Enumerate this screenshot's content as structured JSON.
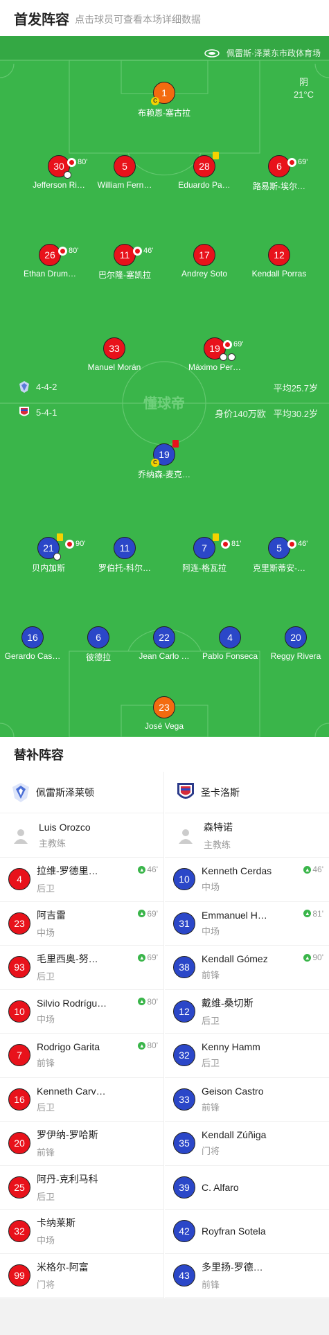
{
  "header": {
    "title": "首发阵容",
    "subtitle": "点击球员可查看本场详细数据"
  },
  "venue": {
    "name": "佩雷斯·泽莱东市政体育场"
  },
  "weather": {
    "condition": "阴",
    "temp": "21°C"
  },
  "watermark": "懂球帝",
  "home": {
    "formation": "4-4-2",
    "avg_age": "平均25.7岁",
    "players": [
      {
        "num": "1",
        "name": "布赖恩-塞古拉",
        "cap": true,
        "color": "orange"
      },
      {
        "num": "30",
        "name": "Jefferson Ri…",
        "sub": "80'",
        "ball": true
      },
      {
        "num": "5",
        "name": "William Fern…"
      },
      {
        "num": "28",
        "name": "Eduardo Pa…",
        "yellow": true
      },
      {
        "num": "6",
        "name": "路易斯-埃尔…",
        "sub": "69'"
      },
      {
        "num": "26",
        "name": "Ethan Drum…",
        "sub": "80'"
      },
      {
        "num": "11",
        "name": "巴尔隆-塞凯拉",
        "sub": "46'"
      },
      {
        "num": "17",
        "name": "Andrey Soto"
      },
      {
        "num": "12",
        "name": "Kendall Porras"
      },
      {
        "num": "33",
        "name": "Manuel Morán"
      },
      {
        "num": "19",
        "name": "Máximo Per…",
        "sub": "69'",
        "balls": 2
      }
    ]
  },
  "away": {
    "formation": "5-4-1",
    "value": "身价140万欧",
    "avg_age": "平均30.2岁",
    "players": [
      {
        "num": "19",
        "name": "乔纳森-麦克…",
        "cap": true,
        "red": true
      },
      {
        "num": "21",
        "name": "贝内加斯",
        "sub": "90'",
        "yellow": true,
        "ball": true
      },
      {
        "num": "11",
        "name": "罗伯托-科尔…"
      },
      {
        "num": "7",
        "name": "阿连-格瓦拉",
        "sub": "81'",
        "yellow": true
      },
      {
        "num": "5",
        "name": "克里斯蒂安-…",
        "sub": "46'"
      },
      {
        "num": "16",
        "name": "Gerardo Cas…"
      },
      {
        "num": "6",
        "name": "彼德拉"
      },
      {
        "num": "22",
        "name": "Jean Carlo …"
      },
      {
        "num": "4",
        "name": "Pablo Fonseca"
      },
      {
        "num": "20",
        "name": "Reggy Rivera"
      },
      {
        "num": "23",
        "name": "José Vega",
        "color": "orange"
      }
    ]
  },
  "subs": {
    "title": "替补阵容",
    "home": {
      "team": "佩雷斯泽莱顿",
      "coach": {
        "name": "Luis Orozco",
        "role": "主教练"
      },
      "list": [
        {
          "num": "4",
          "name": "拉维-罗德里…",
          "role": "后卫",
          "time": "46'"
        },
        {
          "num": "23",
          "name": "阿吉雷",
          "role": "中场",
          "time": "69'"
        },
        {
          "num": "93",
          "name": "毛里西奥-努…",
          "role": "后卫",
          "time": "69'"
        },
        {
          "num": "10",
          "name": "Silvio Rodrígu…",
          "role": "中场",
          "time": "80'"
        },
        {
          "num": "7",
          "name": "Rodrigo Garita",
          "role": "前锋",
          "time": "80'"
        },
        {
          "num": "16",
          "name": "Kenneth Carv…",
          "role": "后卫",
          "time": ""
        },
        {
          "num": "20",
          "name": "罗伊纳-罗哈斯",
          "role": "前锋",
          "time": ""
        },
        {
          "num": "25",
          "name": "阿丹-克利马科",
          "role": "后卫",
          "time": ""
        },
        {
          "num": "32",
          "name": "卡纳莱斯",
          "role": "中场",
          "time": ""
        },
        {
          "num": "99",
          "name": "米格尔-阿富",
          "role": "门将",
          "time": ""
        }
      ]
    },
    "away": {
      "team": "圣卡洛斯",
      "coach": {
        "name": "森特诺",
        "role": "主教练"
      },
      "list": [
        {
          "num": "10",
          "name": "Kenneth Cerdas",
          "role": "中场",
          "time": "46'"
        },
        {
          "num": "31",
          "name": "Emmanuel H…",
          "role": "中场",
          "time": "81'"
        },
        {
          "num": "38",
          "name": "Kendall Gómez",
          "role": "前锋",
          "time": "90'"
        },
        {
          "num": "12",
          "name": "戴维-桑切斯",
          "role": "后卫",
          "time": ""
        },
        {
          "num": "32",
          "name": "Kenny Hamm",
          "role": "后卫",
          "time": ""
        },
        {
          "num": "33",
          "name": "Geison Castro",
          "role": "前锋",
          "time": ""
        },
        {
          "num": "35",
          "name": "Kendall Zúñiga",
          "role": "门将",
          "time": ""
        },
        {
          "num": "39",
          "name": "C. Alfaro",
          "role": "",
          "time": ""
        },
        {
          "num": "42",
          "name": "Royfran Sotela",
          "role": "",
          "time": ""
        },
        {
          "num": "43",
          "name": "多里扬-罗德…",
          "role": "前锋",
          "time": ""
        }
      ]
    }
  }
}
